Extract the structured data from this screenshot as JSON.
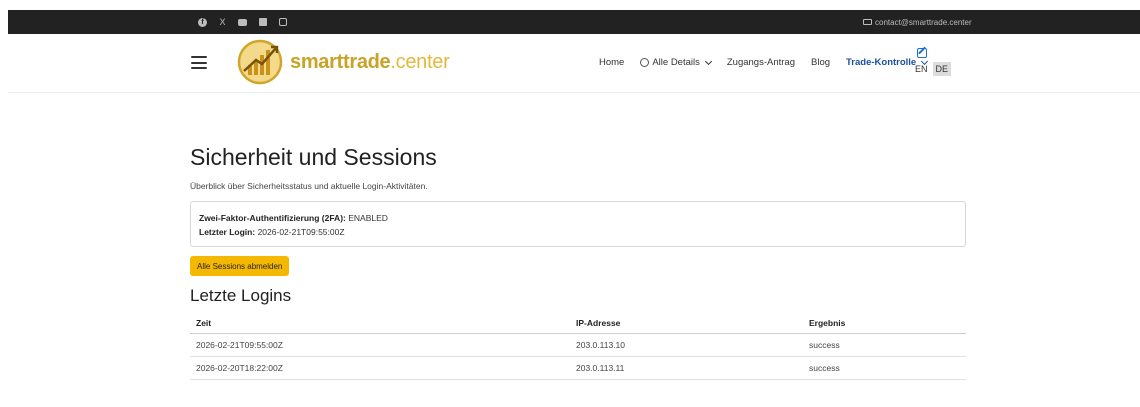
{
  "topbar": {
    "social_icons": [
      "facebook-icon",
      "x-icon",
      "youtube-icon",
      "linkedin-icon",
      "instagram-icon"
    ],
    "x_glyph": "X",
    "facebook_glyph": "f",
    "contact_email": "contact@smarttrade.center"
  },
  "brand": {
    "name_part1": "smarttrade",
    "name_part2": ".center",
    "primary_color": "#c9a227"
  },
  "nav": {
    "home": "Home",
    "details": "Alle Details",
    "access": "Zugangs-Antrag",
    "blog": "Blog",
    "trade_control": "Trade-Kontrolle",
    "active_color": "#1a4fa0"
  },
  "lang": {
    "en": "EN",
    "de": "DE",
    "selected": "DE"
  },
  "page": {
    "title": "Sicherheit und Sessions",
    "subtitle": "Überblick über Sicherheitsstatus und aktuelle Login-Aktivitäten.",
    "twofa_label": "Zwei-Faktor-Authentifizierung (2FA):",
    "twofa_value": "ENABLED",
    "last_login_label": "Letzter Login:",
    "last_login_value": "2026-02-21T09:55:00Z",
    "logout_button": "Alle Sessions abmelden",
    "button_color": "#f5b800",
    "logins_heading": "Letzte Logins"
  },
  "logins_table": {
    "headers": [
      "Zeit",
      "IP-Adresse",
      "Ergebnis"
    ],
    "rows": [
      [
        "2026-02-21T09:55:00Z",
        "203.0.113.10",
        "success"
      ],
      [
        "2026-02-20T18:22:00Z",
        "203.0.113.11",
        "success"
      ]
    ]
  }
}
